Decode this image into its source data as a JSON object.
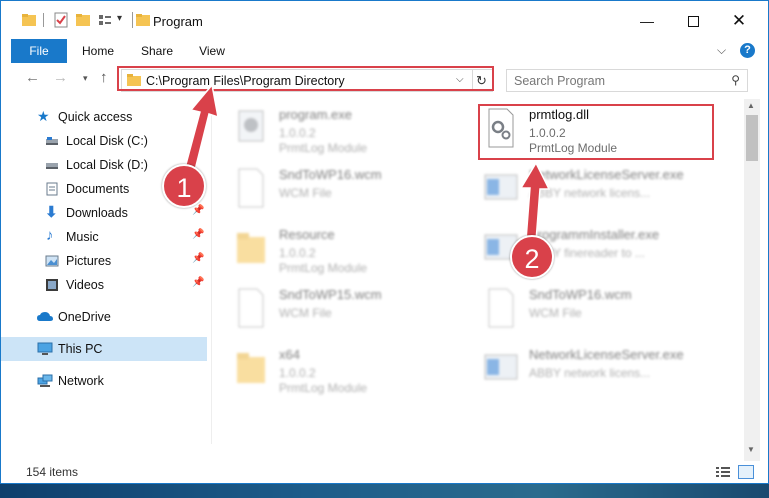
{
  "window": {
    "title": "Program"
  },
  "ribbon": {
    "tabs": [
      "File",
      "Home",
      "Share",
      "View"
    ]
  },
  "address": {
    "path": "C:\\Program Files\\Program Directory"
  },
  "search": {
    "placeholder": "Search Program"
  },
  "sidebar": {
    "items": [
      {
        "label": "Quick access",
        "icon": "star-icon"
      },
      {
        "label": "Local Disk (C:)",
        "icon": "drive-icon"
      },
      {
        "label": "Local Disk (D:)",
        "icon": "drive-icon"
      },
      {
        "label": "Documents",
        "icon": "documents-icon"
      },
      {
        "label": "Downloads",
        "icon": "download-icon"
      },
      {
        "label": "Music",
        "icon": "music-icon"
      },
      {
        "label": "Pictures",
        "icon": "pictures-icon"
      },
      {
        "label": "Videos",
        "icon": "videos-icon"
      },
      {
        "label": "OneDrive",
        "icon": "cloud-icon"
      },
      {
        "label": "This PC",
        "icon": "computer-icon"
      },
      {
        "label": "Network",
        "icon": "network-icon"
      }
    ]
  },
  "files": {
    "left": [
      {
        "name": "program.exe",
        "line1": "1.0.0.2",
        "line2": "PrmtLog Module",
        "kind": "exe"
      },
      {
        "name": "SndToWP16.wcm",
        "line1": "WCM File",
        "line2": "",
        "kind": "blank"
      },
      {
        "name": "Resource",
        "line1": "1.0.0.2",
        "line2": "PrmtLog Module",
        "kind": "folder"
      },
      {
        "name": "SndToWP15.wcm",
        "line1": "WCM File",
        "line2": "",
        "kind": "blank"
      },
      {
        "name": "x64",
        "line1": "1.0.0.2",
        "line2": "PrmtLog Module",
        "kind": "folder"
      }
    ],
    "right": [
      {
        "name": "prmtlog.dll",
        "line1": "1.0.0.2",
        "line2": "PrmtLog Module",
        "kind": "dll"
      },
      {
        "name": "NetworkLicenseServer.exe",
        "line1": "ABBY network licens...",
        "line2": "",
        "kind": "app"
      },
      {
        "name": "ProgrammInstaller.exe",
        "line1": "ABBY finereader to ...",
        "line2": "",
        "kind": "app"
      },
      {
        "name": "SndToWP16.wcm",
        "line1": "WCM File",
        "line2": "",
        "kind": "blank"
      },
      {
        "name": "NetworkLicenseServer.exe",
        "line1": "ABBY network licens...",
        "line2": "",
        "kind": "app"
      }
    ]
  },
  "status": {
    "item_count": "154 items"
  },
  "annotations": {
    "step1": "1",
    "step2": "2",
    "color": "#d9414a"
  },
  "colors": {
    "accent": "#1979ca",
    "selection": "#cce4f7",
    "annotation": "#d9414a"
  }
}
